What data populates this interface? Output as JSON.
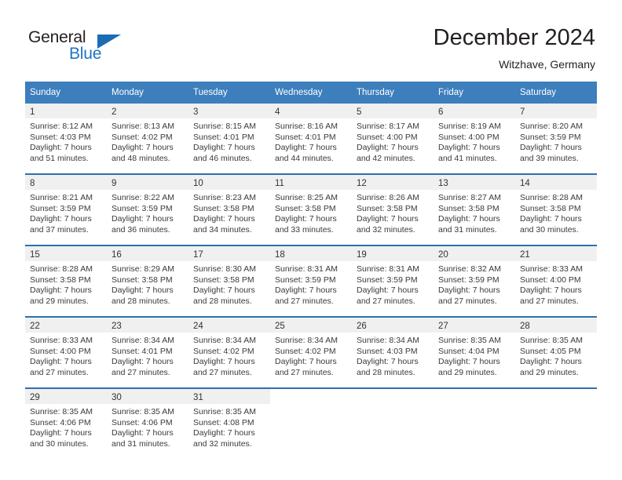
{
  "brand": {
    "name_part1": "General",
    "name_part2": "Blue"
  },
  "header": {
    "month_title": "December 2024",
    "location": "Witzhave, Germany"
  },
  "colors": {
    "header_blue": "#3d7ebc",
    "row_border_blue": "#2f6fae",
    "date_band_gray": "#f0f0f0",
    "brand_blue": "#1f73c4",
    "text": "#231f20"
  },
  "calendar": {
    "weekday_headers": [
      "Sunday",
      "Monday",
      "Tuesday",
      "Wednesday",
      "Thursday",
      "Friday",
      "Saturday"
    ],
    "weeks": [
      [
        {
          "day": "1",
          "sunrise": "Sunrise: 8:12 AM",
          "sunset": "Sunset: 4:03 PM",
          "daylight_line1": "Daylight: 7 hours",
          "daylight_line2": "and 51 minutes."
        },
        {
          "day": "2",
          "sunrise": "Sunrise: 8:13 AM",
          "sunset": "Sunset: 4:02 PM",
          "daylight_line1": "Daylight: 7 hours",
          "daylight_line2": "and 48 minutes."
        },
        {
          "day": "3",
          "sunrise": "Sunrise: 8:15 AM",
          "sunset": "Sunset: 4:01 PM",
          "daylight_line1": "Daylight: 7 hours",
          "daylight_line2": "and 46 minutes."
        },
        {
          "day": "4",
          "sunrise": "Sunrise: 8:16 AM",
          "sunset": "Sunset: 4:01 PM",
          "daylight_line1": "Daylight: 7 hours",
          "daylight_line2": "and 44 minutes."
        },
        {
          "day": "5",
          "sunrise": "Sunrise: 8:17 AM",
          "sunset": "Sunset: 4:00 PM",
          "daylight_line1": "Daylight: 7 hours",
          "daylight_line2": "and 42 minutes."
        },
        {
          "day": "6",
          "sunrise": "Sunrise: 8:19 AM",
          "sunset": "Sunset: 4:00 PM",
          "daylight_line1": "Daylight: 7 hours",
          "daylight_line2": "and 41 minutes."
        },
        {
          "day": "7",
          "sunrise": "Sunrise: 8:20 AM",
          "sunset": "Sunset: 3:59 PM",
          "daylight_line1": "Daylight: 7 hours",
          "daylight_line2": "and 39 minutes."
        }
      ],
      [
        {
          "day": "8",
          "sunrise": "Sunrise: 8:21 AM",
          "sunset": "Sunset: 3:59 PM",
          "daylight_line1": "Daylight: 7 hours",
          "daylight_line2": "and 37 minutes."
        },
        {
          "day": "9",
          "sunrise": "Sunrise: 8:22 AM",
          "sunset": "Sunset: 3:59 PM",
          "daylight_line1": "Daylight: 7 hours",
          "daylight_line2": "and 36 minutes."
        },
        {
          "day": "10",
          "sunrise": "Sunrise: 8:23 AM",
          "sunset": "Sunset: 3:58 PM",
          "daylight_line1": "Daylight: 7 hours",
          "daylight_line2": "and 34 minutes."
        },
        {
          "day": "11",
          "sunrise": "Sunrise: 8:25 AM",
          "sunset": "Sunset: 3:58 PM",
          "daylight_line1": "Daylight: 7 hours",
          "daylight_line2": "and 33 minutes."
        },
        {
          "day": "12",
          "sunrise": "Sunrise: 8:26 AM",
          "sunset": "Sunset: 3:58 PM",
          "daylight_line1": "Daylight: 7 hours",
          "daylight_line2": "and 32 minutes."
        },
        {
          "day": "13",
          "sunrise": "Sunrise: 8:27 AM",
          "sunset": "Sunset: 3:58 PM",
          "daylight_line1": "Daylight: 7 hours",
          "daylight_line2": "and 31 minutes."
        },
        {
          "day": "14",
          "sunrise": "Sunrise: 8:28 AM",
          "sunset": "Sunset: 3:58 PM",
          "daylight_line1": "Daylight: 7 hours",
          "daylight_line2": "and 30 minutes."
        }
      ],
      [
        {
          "day": "15",
          "sunrise": "Sunrise: 8:28 AM",
          "sunset": "Sunset: 3:58 PM",
          "daylight_line1": "Daylight: 7 hours",
          "daylight_line2": "and 29 minutes."
        },
        {
          "day": "16",
          "sunrise": "Sunrise: 8:29 AM",
          "sunset": "Sunset: 3:58 PM",
          "daylight_line1": "Daylight: 7 hours",
          "daylight_line2": "and 28 minutes."
        },
        {
          "day": "17",
          "sunrise": "Sunrise: 8:30 AM",
          "sunset": "Sunset: 3:58 PM",
          "daylight_line1": "Daylight: 7 hours",
          "daylight_line2": "and 28 minutes."
        },
        {
          "day": "18",
          "sunrise": "Sunrise: 8:31 AM",
          "sunset": "Sunset: 3:59 PM",
          "daylight_line1": "Daylight: 7 hours",
          "daylight_line2": "and 27 minutes."
        },
        {
          "day": "19",
          "sunrise": "Sunrise: 8:31 AM",
          "sunset": "Sunset: 3:59 PM",
          "daylight_line1": "Daylight: 7 hours",
          "daylight_line2": "and 27 minutes."
        },
        {
          "day": "20",
          "sunrise": "Sunrise: 8:32 AM",
          "sunset": "Sunset: 3:59 PM",
          "daylight_line1": "Daylight: 7 hours",
          "daylight_line2": "and 27 minutes."
        },
        {
          "day": "21",
          "sunrise": "Sunrise: 8:33 AM",
          "sunset": "Sunset: 4:00 PM",
          "daylight_line1": "Daylight: 7 hours",
          "daylight_line2": "and 27 minutes."
        }
      ],
      [
        {
          "day": "22",
          "sunrise": "Sunrise: 8:33 AM",
          "sunset": "Sunset: 4:00 PM",
          "daylight_line1": "Daylight: 7 hours",
          "daylight_line2": "and 27 minutes."
        },
        {
          "day": "23",
          "sunrise": "Sunrise: 8:34 AM",
          "sunset": "Sunset: 4:01 PM",
          "daylight_line1": "Daylight: 7 hours",
          "daylight_line2": "and 27 minutes."
        },
        {
          "day": "24",
          "sunrise": "Sunrise: 8:34 AM",
          "sunset": "Sunset: 4:02 PM",
          "daylight_line1": "Daylight: 7 hours",
          "daylight_line2": "and 27 minutes."
        },
        {
          "day": "25",
          "sunrise": "Sunrise: 8:34 AM",
          "sunset": "Sunset: 4:02 PM",
          "daylight_line1": "Daylight: 7 hours",
          "daylight_line2": "and 27 minutes."
        },
        {
          "day": "26",
          "sunrise": "Sunrise: 8:34 AM",
          "sunset": "Sunset: 4:03 PM",
          "daylight_line1": "Daylight: 7 hours",
          "daylight_line2": "and 28 minutes."
        },
        {
          "day": "27",
          "sunrise": "Sunrise: 8:35 AM",
          "sunset": "Sunset: 4:04 PM",
          "daylight_line1": "Daylight: 7 hours",
          "daylight_line2": "and 29 minutes."
        },
        {
          "day": "28",
          "sunrise": "Sunrise: 8:35 AM",
          "sunset": "Sunset: 4:05 PM",
          "daylight_line1": "Daylight: 7 hours",
          "daylight_line2": "and 29 minutes."
        }
      ],
      [
        {
          "day": "29",
          "sunrise": "Sunrise: 8:35 AM",
          "sunset": "Sunset: 4:06 PM",
          "daylight_line1": "Daylight: 7 hours",
          "daylight_line2": "and 30 minutes."
        },
        {
          "day": "30",
          "sunrise": "Sunrise: 8:35 AM",
          "sunset": "Sunset: 4:06 PM",
          "daylight_line1": "Daylight: 7 hours",
          "daylight_line2": "and 31 minutes."
        },
        {
          "day": "31",
          "sunrise": "Sunrise: 8:35 AM",
          "sunset": "Sunset: 4:08 PM",
          "daylight_line1": "Daylight: 7 hours",
          "daylight_line2": "and 32 minutes."
        },
        {
          "day": "",
          "sunrise": "",
          "sunset": "",
          "daylight_line1": "",
          "daylight_line2": ""
        },
        {
          "day": "",
          "sunrise": "",
          "sunset": "",
          "daylight_line1": "",
          "daylight_line2": ""
        },
        {
          "day": "",
          "sunrise": "",
          "sunset": "",
          "daylight_line1": "",
          "daylight_line2": ""
        },
        {
          "day": "",
          "sunrise": "",
          "sunset": "",
          "daylight_line1": "",
          "daylight_line2": ""
        }
      ]
    ]
  }
}
